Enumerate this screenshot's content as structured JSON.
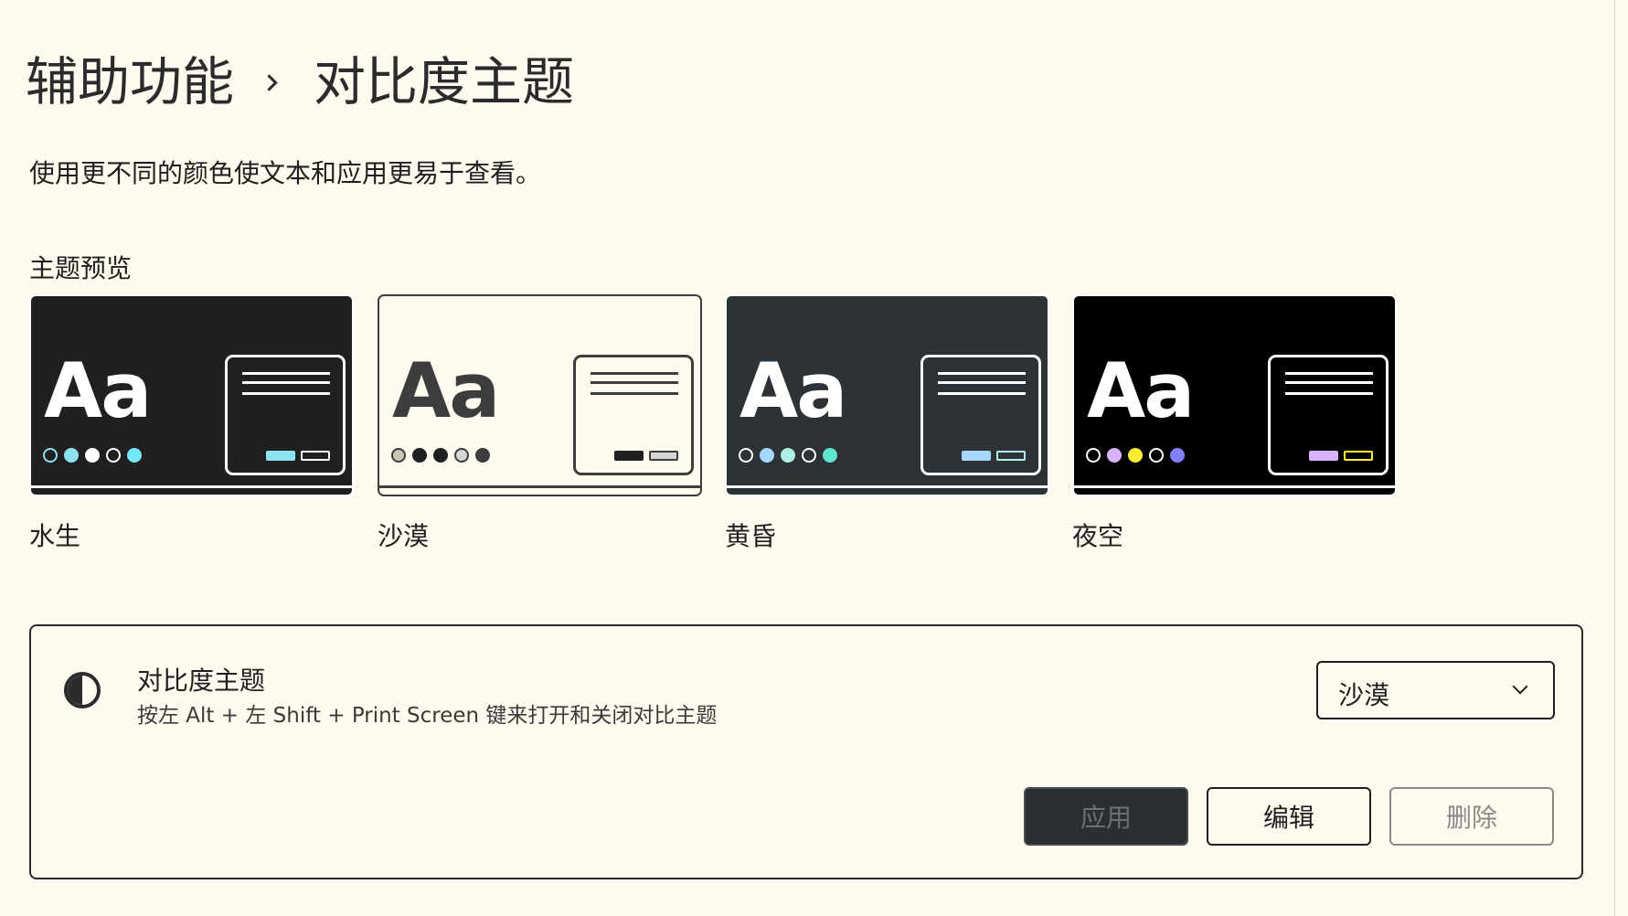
{
  "header": {
    "parent": "辅助功能",
    "current": "对比度主题"
  },
  "description": "使用更不同的颜色使文本和应用更易于查看。",
  "preview": {
    "title": "主题预览",
    "sample_text": "Aa",
    "themes": [
      {
        "name": "水生",
        "colors": {
          "bg": "#202020",
          "text": "#ffffff",
          "border": "#ffffff",
          "btn1": "#8ee3f0",
          "btn2_border": "#ffffff",
          "btn2_fill": "#202020"
        },
        "dots": [
          {
            "fill": "#202020",
            "border": "#8ee3f0"
          },
          {
            "fill": "#8ee3f0",
            "border": "#8ee3f0"
          },
          {
            "fill": "#ffffff",
            "border": "#ffffff"
          },
          {
            "fill": "#202020",
            "border": "#ffffff"
          },
          {
            "fill": "#75e9fc",
            "border": "#75e9fc"
          }
        ]
      },
      {
        "name": "沙漠",
        "colors": {
          "bg": "#fffaef",
          "text": "#3d3d3d",
          "border": "#3d3d3d",
          "btn1": "#202020",
          "btn2_border": "#3d3d3d",
          "btn2_fill": "#d6d6d6"
        },
        "dots": [
          {
            "fill": "#c9c4b4",
            "border": "#3d3d3d"
          },
          {
            "fill": "#202020",
            "border": "#202020"
          },
          {
            "fill": "#202020",
            "border": "#202020"
          },
          {
            "fill": "#d6d6d6",
            "border": "#3d3d3d"
          },
          {
            "fill": "#3d3d3d",
            "border": "#3d3d3d"
          }
        ]
      },
      {
        "name": "黄昏",
        "colors": {
          "bg": "#2d3236",
          "text": "#ffffff",
          "border": "#ffffff",
          "btn1": "#a6d8ff",
          "btn2_border": "#aef0e8",
          "btn2_fill": "#2d3236"
        },
        "dots": [
          {
            "fill": "#2d3236",
            "border": "#ffffff"
          },
          {
            "fill": "#a6d8ff",
            "border": "#a6d8ff"
          },
          {
            "fill": "#aef0e8",
            "border": "#aef0e8"
          },
          {
            "fill": "#2d3236",
            "border": "#ffffff"
          },
          {
            "fill": "#5ee6d0",
            "border": "#5ee6d0"
          }
        ]
      },
      {
        "name": "夜空",
        "colors": {
          "bg": "#000000",
          "text": "#ffffff",
          "border": "#ffffff",
          "btn1": "#d6b4fd",
          "btn2_border": "#ffee32",
          "btn2_fill": "#000000"
        },
        "dots": [
          {
            "fill": "#000000",
            "border": "#ffffff"
          },
          {
            "fill": "#d6b4fd",
            "border": "#d6b4fd"
          },
          {
            "fill": "#ffee32",
            "border": "#ffee32"
          },
          {
            "fill": "#000000",
            "border": "#ffffff"
          },
          {
            "fill": "#8080ff",
            "border": "#8080ff"
          }
        ]
      }
    ]
  },
  "setting": {
    "icon": "contrast-icon",
    "title": "对比度主题",
    "subtitle": "按左 Alt + 左 Shift + Print Screen 键来打开和关闭对比主题",
    "selected_theme": "沙漠",
    "buttons": {
      "apply": "应用",
      "edit": "编辑",
      "delete": "删除"
    }
  }
}
